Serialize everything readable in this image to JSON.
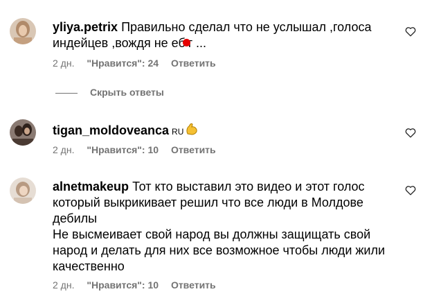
{
  "comments": [
    {
      "username": "yliya.petrix",
      "text_line1": "Правильно сделал что не услышал ,голоса",
      "text_line2_part1": "индейцев ,вождя не еб",
      "text_line2_part2": "т ...",
      "age": "2 дн.",
      "likes": "\"Нравится\": 24",
      "reply": "Ответить"
    },
    {
      "username": "tigan_moldoveanca",
      "country": "RU",
      "emoji": "flexed-biceps-icon",
      "age": "2 дн.",
      "likes": "\"Нравится\": 10",
      "reply": "Ответить"
    },
    {
      "username": "alnetmakeup",
      "text_line1": "Тот кто выставил это видео и этот голос",
      "text_line2": "который выкрикивает решил что все люди в Молдове",
      "text_line3": "дебилы",
      "text_line4": "Не высмеивает свой народ вы должны защищать свой",
      "text_line5": "народ и делать для них все возможное чтобы люди жили",
      "text_line6": "качественно",
      "age": "2 дн.",
      "likes": "\"Нравится\": 10",
      "reply": "Ответить"
    }
  ],
  "hide_replies": "Скрыть ответы",
  "colors": {
    "meta": "#737373",
    "redaction": "#e60000"
  }
}
